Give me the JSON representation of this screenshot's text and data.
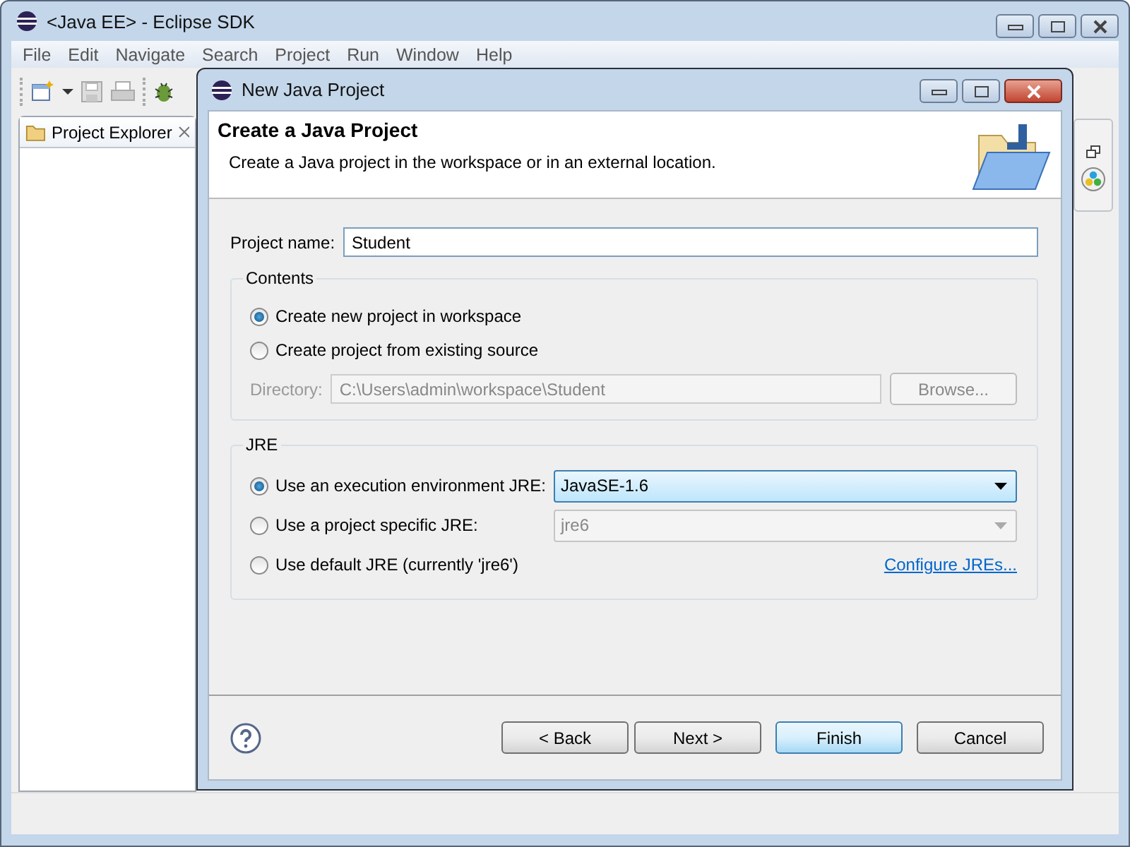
{
  "window": {
    "title": "<Java EE> - Eclipse SDK"
  },
  "menu": [
    "File",
    "Edit",
    "Navigate",
    "Search",
    "Project",
    "Run",
    "Window",
    "Help"
  ],
  "explorer": {
    "title": "Project Explorer"
  },
  "dialog": {
    "title": "New Java Project",
    "heading": "Create a Java Project",
    "description": "Create a Java project in the workspace or in an external location.",
    "project_name": {
      "label": "Project name:",
      "value": "Student"
    },
    "contents": {
      "title": "Contents",
      "options": [
        {
          "label": "Create new project in workspace",
          "selected": true
        },
        {
          "label": "Create project from existing source",
          "selected": false
        }
      ],
      "directory": {
        "label": "Directory:",
        "value": "C:\\Users\\admin\\workspace\\Student",
        "disabled": true
      },
      "browse": {
        "label": "Browse...",
        "disabled": true
      }
    },
    "jre": {
      "title": "JRE",
      "options": [
        {
          "kind": "dropdown",
          "label": "Use an execution environment JRE:",
          "selected": true,
          "value": "JavaSE-1.6",
          "disabled": false
        },
        {
          "kind": "dropdown",
          "label": "Use a project specific JRE:",
          "selected": false,
          "value": "jre6",
          "disabled": true
        },
        {
          "kind": "link",
          "label": "Use default JRE (currently 'jre6')",
          "selected": false,
          "link": "Configure JREs..."
        }
      ]
    },
    "buttons": [
      {
        "label": "< Back",
        "default": false
      },
      {
        "label": "Next >",
        "default": false
      },
      {
        "label": "Finish",
        "default": true
      },
      {
        "label": "Cancel",
        "default": false
      }
    ]
  }
}
